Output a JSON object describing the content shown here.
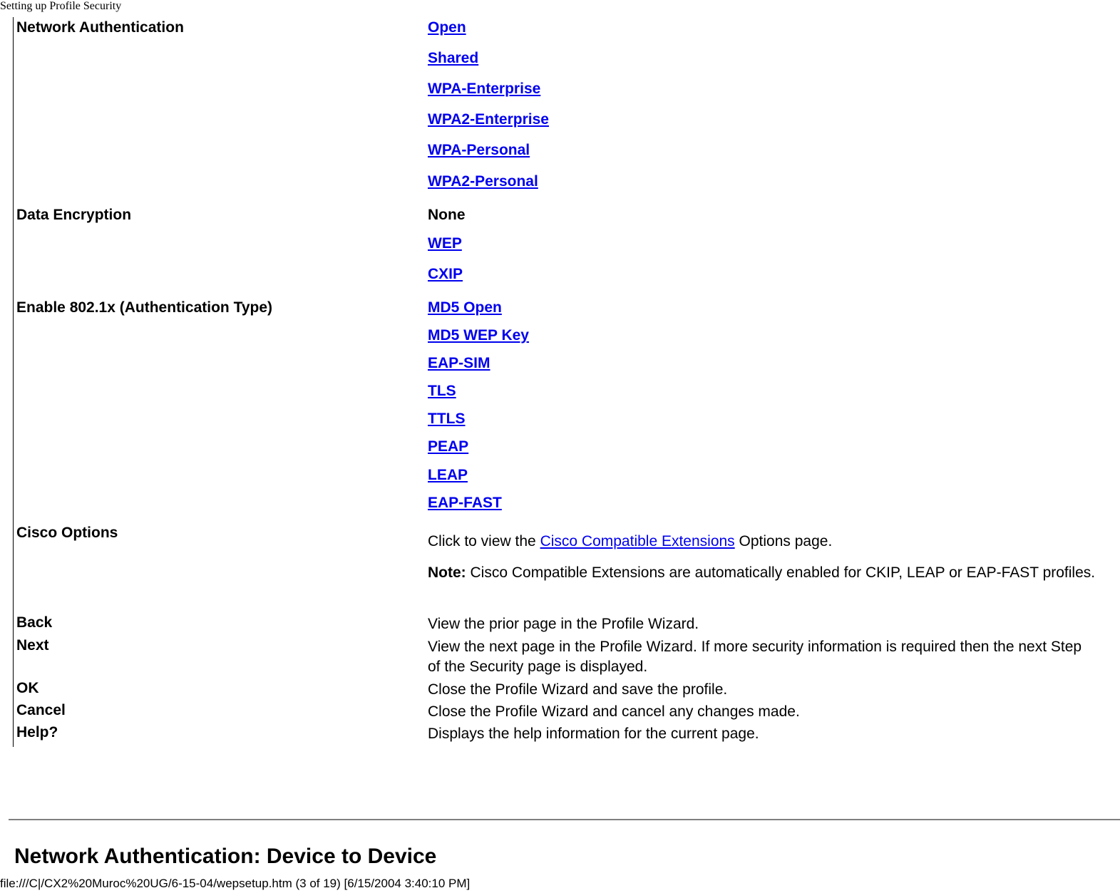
{
  "header": {
    "title": "Setting up Profile Security"
  },
  "table": {
    "network_authentication": {
      "label": "Network Authentication",
      "options": [
        "Open",
        "Shared",
        "WPA-Enterprise",
        "WPA2-Enterprise",
        "WPA-Personal",
        "WPA2-Personal"
      ]
    },
    "data_encryption": {
      "label": "Data Encryption",
      "plain_option": "None",
      "options": [
        "WEP",
        "CXIP"
      ]
    },
    "enable_8021x": {
      "label": "Enable 802.1x (Authentication Type)",
      "options": [
        "MD5 Open",
        "MD5 WEP Key",
        "EAP-SIM",
        "TLS",
        "TTLS",
        "PEAP",
        "LEAP",
        "EAP-FAST"
      ]
    },
    "cisco_options": {
      "label": "Cisco Options",
      "text_before": "Click to view the ",
      "link": "Cisco Compatible Extensions",
      "text_after": " Options page.",
      "note_label": "Note:",
      "note_text": " Cisco Compatible Extensions are automatically enabled for CKIP, LEAP or EAP-FAST profiles."
    },
    "buttons": [
      {
        "label": "Back",
        "description": "View the prior page in the Profile Wizard."
      },
      {
        "label": "Next",
        "description": "View the next page in the Profile Wizard. If more security information is required then the next Step of the Security page is displayed."
      },
      {
        "label": "OK",
        "description": "Close the Profile Wizard and save the profile."
      },
      {
        "label": "Cancel",
        "description": "Close the Profile Wizard and cancel any changes made."
      },
      {
        "label": "Help?",
        "description": "Displays the help information for the current page."
      }
    ]
  },
  "section": {
    "title": "Network Authentication: Device to Device"
  },
  "footer": {
    "text": "file:///C|/CX2%20Muroc%20UG/6-15-04/wepsetup.htm (3 of 19) [6/15/2004 3:40:10 PM]"
  }
}
